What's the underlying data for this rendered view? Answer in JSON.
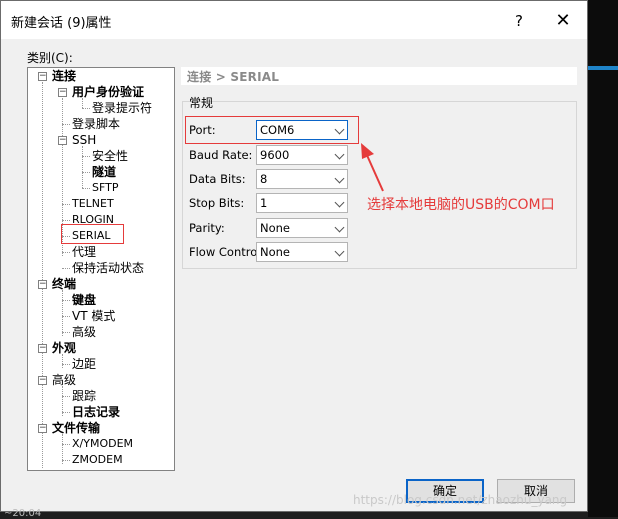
{
  "window": {
    "title": "新建会话 (9)属性",
    "help_glyph": "?",
    "close_glyph": "✕"
  },
  "category_label": "类别(C):",
  "tree": {
    "connection": "连接",
    "auth": "用户身份验证",
    "login_prompt": "登录提示符",
    "login_script": "登录脚本",
    "ssh": "SSH",
    "security": "安全性",
    "tunnel": "隧道",
    "sftp": "SFTP",
    "telnet": "TELNET",
    "rlogin": "RLOGIN",
    "serial": "SERIAL",
    "proxy": "代理",
    "keepalive": "保持活动状态",
    "terminal": "终端",
    "keyboard": "键盘",
    "vt_mode": "VT 模式",
    "advanced": "高级",
    "appearance": "外观",
    "margin": "边距",
    "advanced2": "高级",
    "trace": "跟踪",
    "log": "日志记录",
    "file_transfer": "文件传输",
    "xymodem": "X/YMODEM",
    "zmodem": "ZMODEM"
  },
  "breadcrumb": "连接 > SERIAL",
  "group_label": "常规",
  "fields": [
    {
      "label": "Port:",
      "value": "COM6"
    },
    {
      "label": "Baud Rate:",
      "value": "9600"
    },
    {
      "label": "Data Bits:",
      "value": "8"
    },
    {
      "label": "Stop Bits:",
      "value": "1"
    },
    {
      "label": "Parity:",
      "value": "None"
    },
    {
      "label": "Flow Control:",
      "value": "None"
    }
  ],
  "annotation": "选择本地电脑的USB的COM口",
  "buttons": {
    "ok": "确定",
    "cancel": "取消"
  },
  "watermark": "https://blog.csdn.net/zhaozhu_yang",
  "corner_text": "~20:04",
  "colors": {
    "annotation": "#e53b3b",
    "focus": "#0a64c8"
  }
}
